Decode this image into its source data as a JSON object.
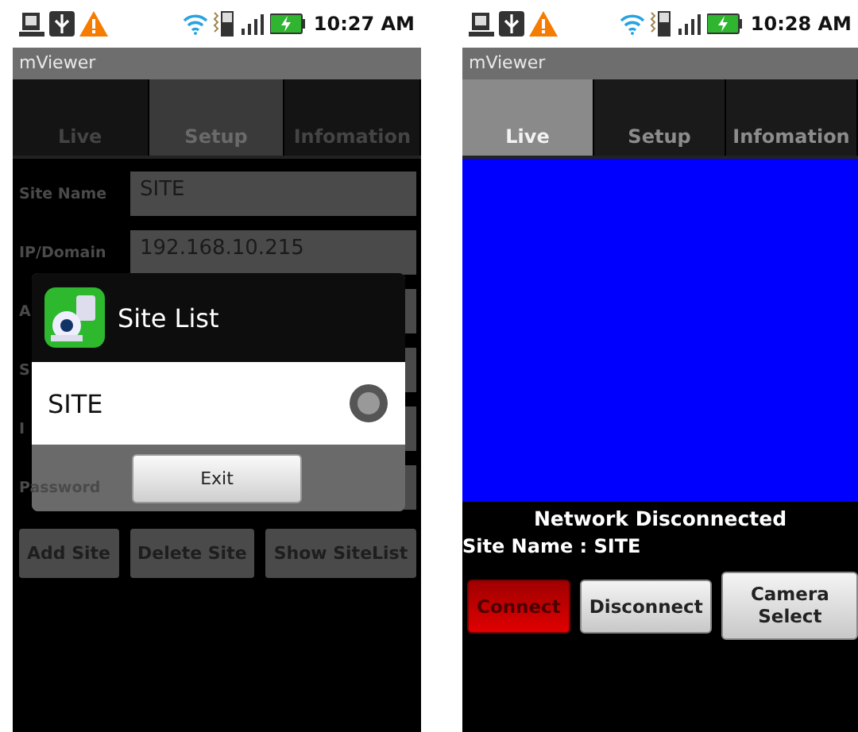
{
  "screens": [
    {
      "kind": "setup",
      "status_bar": {
        "time": "10:27 AM"
      },
      "app_title": "mViewer",
      "tabs": [
        {
          "label": "Live",
          "selected": false
        },
        {
          "label": "Setup",
          "selected": true
        },
        {
          "label": "Infomation",
          "selected": false
        }
      ],
      "fields": [
        {
          "label": "Site Name",
          "value": "SITE"
        },
        {
          "label": "IP/Domain",
          "value": "192.168.10.215"
        },
        {
          "label": "A"
        },
        {
          "label": "S"
        },
        {
          "label": "I"
        },
        {
          "label": "Password"
        }
      ],
      "buttons": [
        {
          "label": "Add Site"
        },
        {
          "label": "Delete Site"
        },
        {
          "label": "Show SiteList"
        }
      ],
      "dialog": {
        "title": "Site List",
        "items": [
          {
            "label": "SITE",
            "selected": false
          }
        ],
        "button": "Exit"
      }
    },
    {
      "kind": "live",
      "status_bar": {
        "time": "10:28 AM"
      },
      "app_title": "mViewer",
      "tabs": [
        {
          "label": "Live",
          "selected": true
        },
        {
          "label": "Setup",
          "selected": false
        },
        {
          "label": "Infomation",
          "selected": false
        }
      ],
      "status_message": "Network Disconnected",
      "site_name": "Site Name : SITE",
      "buttons": [
        {
          "label": "Connect",
          "highlighted": true
        },
        {
          "label": "Disconnect",
          "highlighted": false
        },
        {
          "label": "Camera Select",
          "highlighted": false
        }
      ]
    }
  ]
}
